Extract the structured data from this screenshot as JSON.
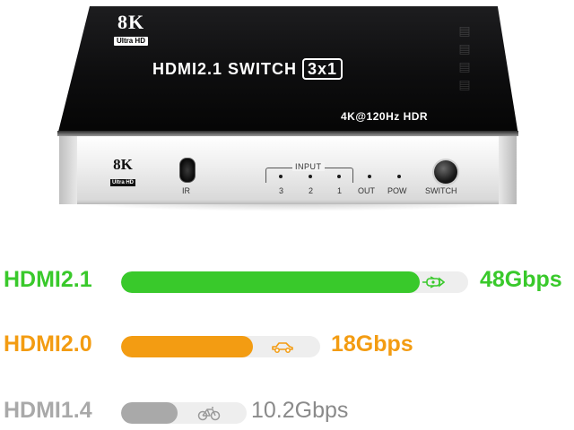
{
  "device": {
    "top_brand": {
      "resolution": "8K",
      "tag": "Ultra HD"
    },
    "title": "HDMI2.1 SWITCH",
    "title_badge": "3x1",
    "subtitle": "4K@120Hz  HDR",
    "front_brand": {
      "resolution": "8K",
      "tag": "Ultra HD"
    },
    "ir_label": "IR",
    "input_group_label": "INPUT",
    "input_labels": [
      "3",
      "2",
      "1"
    ],
    "out_label": "OUT",
    "pow_label": "POW",
    "switch_label": "SWITCH"
  },
  "bandwidth": {
    "rows": [
      {
        "name": "HDMI2.1",
        "speed": "48Gbps",
        "color": "#39c92b",
        "fill_fraction": 0.86,
        "icon": "rocket-icon"
      },
      {
        "name": "HDMI2.0",
        "speed": "18Gbps",
        "color": "#f39c12",
        "fill_fraction": 0.66,
        "icon": "car-icon"
      },
      {
        "name": "HDMI1.4",
        "speed": "10.2Gbps",
        "color": "#a9a9a9",
        "fill_fraction": 0.45,
        "icon": "bicycle-icon"
      }
    ]
  }
}
